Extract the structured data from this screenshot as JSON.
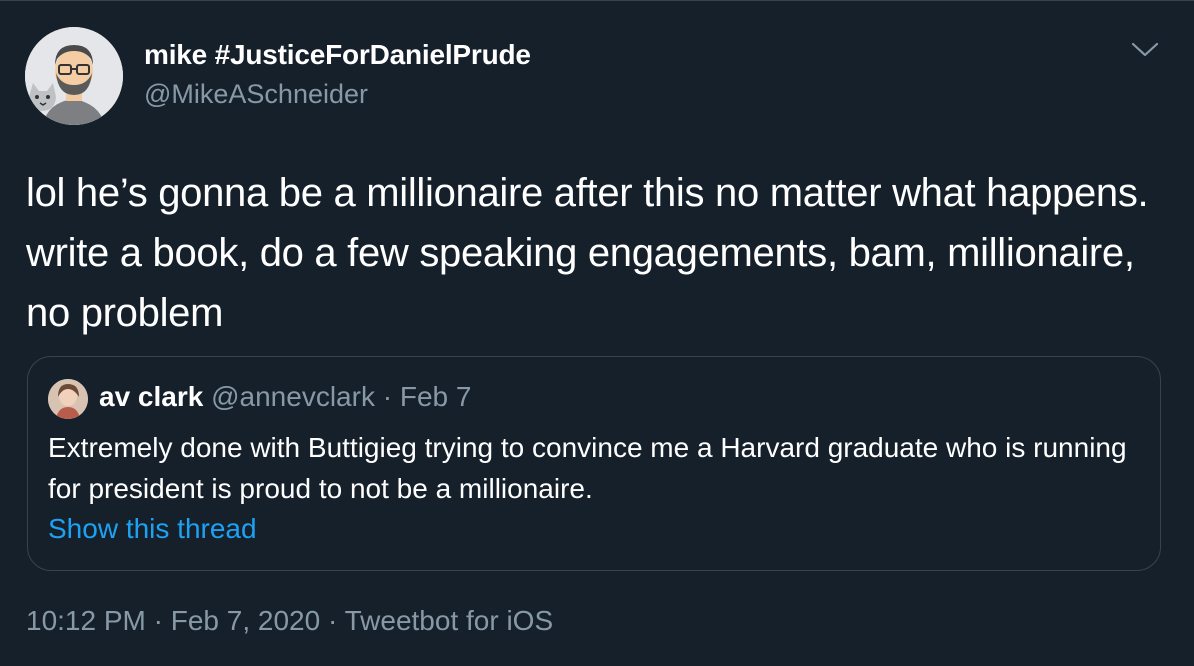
{
  "author": {
    "display_name": "mike #JusticeForDanielPrude",
    "handle": "@MikeASchneider",
    "avatar": "cartoon-avatar-icon"
  },
  "menu_icon": "chevron-down-icon",
  "tweet_text": "lol he’s gonna be a millionaire after this no matter what happens. write a book, do a few speaking engagements, bam, millionaire, no problem",
  "quoted_tweet": {
    "display_name": "av clark",
    "handle": "@annevclark",
    "separator": "·",
    "date": "Feb 7",
    "text": "Extremely done with Buttigieg trying to convince me a Harvard graduate who is running for president is proud to not be a millionaire.",
    "show_thread_label": "Show this thread"
  },
  "meta": {
    "time": "10:12 PM",
    "separator1": "·",
    "date": "Feb 7, 2020",
    "separator2": "·",
    "source": "Tweetbot for iOS"
  },
  "colors": {
    "background": "#15202b",
    "border": "#38444d",
    "text_primary": "#ffffff",
    "text_secondary": "#8899a6",
    "link": "#1da1f2"
  }
}
